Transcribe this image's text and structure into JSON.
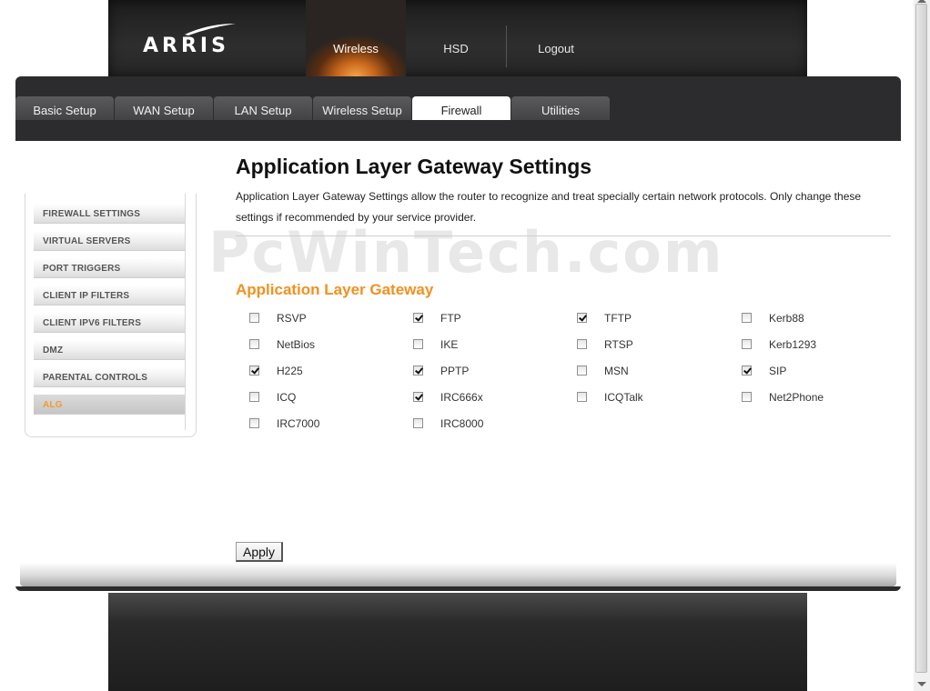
{
  "header": {
    "logo_text": "ARRIS",
    "topnav": [
      {
        "label": "Wireless",
        "active": true
      },
      {
        "label": "HSD",
        "active": false
      },
      {
        "label": "Logout",
        "active": false
      }
    ]
  },
  "tabs": [
    {
      "label": "Basic Setup",
      "active": false
    },
    {
      "label": "WAN Setup",
      "active": false
    },
    {
      "label": "LAN Setup",
      "active": false
    },
    {
      "label": "Wireless Setup",
      "active": false
    },
    {
      "label": "Firewall",
      "active": true
    },
    {
      "label": "Utilities",
      "active": false
    }
  ],
  "sidebar": {
    "items": [
      {
        "label": "FIREWALL SETTINGS",
        "active": false
      },
      {
        "label": "VIRTUAL SERVERS",
        "active": false
      },
      {
        "label": "PORT TRIGGERS",
        "active": false
      },
      {
        "label": "CLIENT IP FILTERS",
        "active": false
      },
      {
        "label": "CLIENT IPV6 FILTERS",
        "active": false
      },
      {
        "label": "DMZ",
        "active": false
      },
      {
        "label": "PARENTAL CONTROLS",
        "active": false
      },
      {
        "label": "ALG",
        "active": true
      }
    ]
  },
  "main": {
    "title": "Application Layer Gateway Settings",
    "description": "Application Layer Gateway Settings allow the router to recognize and treat specially certain network protocols. Only change these settings if recommended by your service provider.",
    "watermark": "PcWinTech.com",
    "section_title": "Application Layer Gateway",
    "alg_options": [
      {
        "label": "RSVP",
        "checked": false
      },
      {
        "label": "FTP",
        "checked": true
      },
      {
        "label": "TFTP",
        "checked": true
      },
      {
        "label": "Kerb88",
        "checked": false
      },
      {
        "label": "NetBios",
        "checked": false
      },
      {
        "label": "IKE",
        "checked": false
      },
      {
        "label": "RTSP",
        "checked": false
      },
      {
        "label": "Kerb1293",
        "checked": false
      },
      {
        "label": "H225",
        "checked": true
      },
      {
        "label": "PPTP",
        "checked": true
      },
      {
        "label": "MSN",
        "checked": false
      },
      {
        "label": "SIP",
        "checked": true
      },
      {
        "label": "ICQ",
        "checked": false
      },
      {
        "label": "IRC666x",
        "checked": true
      },
      {
        "label": "ICQTalk",
        "checked": false
      },
      {
        "label": "Net2Phone",
        "checked": false
      },
      {
        "label": "IRC7000",
        "checked": false
      },
      {
        "label": "IRC8000",
        "checked": false
      }
    ],
    "apply_label": "Apply"
  },
  "colors": {
    "accent_orange": "#f3901f",
    "frame_dark": "#2c2c2e",
    "tab_active_bg": "#ffffff"
  }
}
